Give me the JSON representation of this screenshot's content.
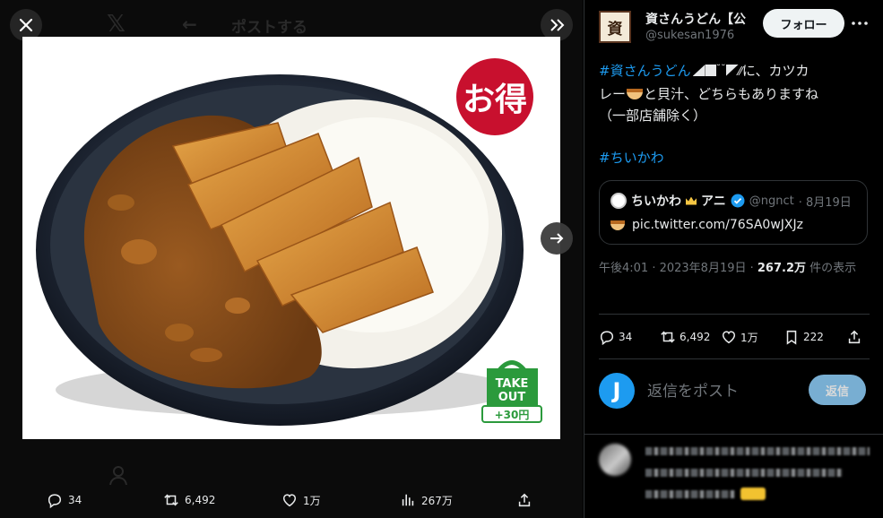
{
  "viewer": {
    "background_title": "ポストする",
    "food_image": {
      "badge_text": "お得",
      "takeout_line1": "TAKE",
      "takeout_line2": "OUT",
      "takeout_price": "+30円"
    },
    "actions": {
      "replies": "34",
      "reposts": "6,492",
      "likes": "1万",
      "views": "267万"
    }
  },
  "post": {
    "author": {
      "display_name": "資さんうどん【公",
      "handle": "@sukesan1976",
      "avatar_glyph": "資"
    },
    "follow_label": "フォロー",
    "text": {
      "hashtag1": "#資さんうどん",
      "line1_rest": "に、カツカ",
      "line2_a": "レー",
      "line2_b": "と貝汁、どちらもありますね",
      "line3": "（一部店舗除く）",
      "hashtag2": "#ちいかわ"
    },
    "quote": {
      "name_a": "ちいかわ",
      "name_b": "アニ",
      "handle": "@ngnct",
      "date": "· 8月19日",
      "link": "pic.twitter.com/76SA0wJXJz"
    },
    "meta": {
      "time": "午後4:01 · 2023年8月19日 · ",
      "views_count": "267.2万",
      "views_label": " 件の表示"
    },
    "stats": {
      "replies": "34",
      "reposts": "6,492",
      "likes": "1万",
      "bookmarks": "222"
    },
    "reply_box": {
      "avatar_letter": "J",
      "placeholder": "返信をポスト",
      "button_label": "返信"
    }
  },
  "colors": {
    "accent": "#1d9bf0",
    "text_primary": "#e7e9ea",
    "text_secondary": "#71767b",
    "border": "#2f3336"
  },
  "icons": [
    "close-icon",
    "expand-icon",
    "next-arrow-icon",
    "reply-icon",
    "repost-icon",
    "like-icon",
    "views-icon",
    "share-icon",
    "bookmark-icon",
    "more-icon",
    "verified-icon"
  ]
}
